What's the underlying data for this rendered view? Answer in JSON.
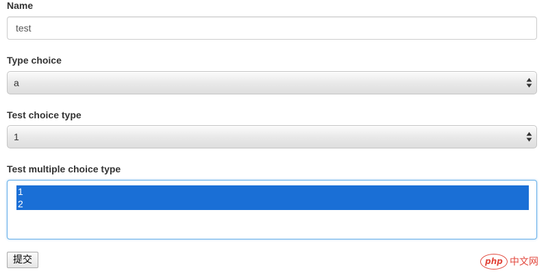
{
  "form": {
    "name_label": "Name",
    "name_value": "test",
    "type_choice_label": "Type choice",
    "type_choice_value": "a",
    "test_choice_label": "Test choice type",
    "test_choice_value": "1",
    "multi_choice_label": "Test multiple choice type",
    "multi_choice_options": [
      {
        "label": "1",
        "selected": true
      },
      {
        "label": "2",
        "selected": true
      }
    ],
    "submit_label": "提交"
  },
  "watermark": {
    "logo_text": "php",
    "site_text": "中文网"
  },
  "colors": {
    "selection": "#1a6fd6",
    "focus_border": "#66afe9",
    "watermark": "#e2473c"
  },
  "icons": {
    "select_arrows": "up-down-arrows-icon"
  }
}
